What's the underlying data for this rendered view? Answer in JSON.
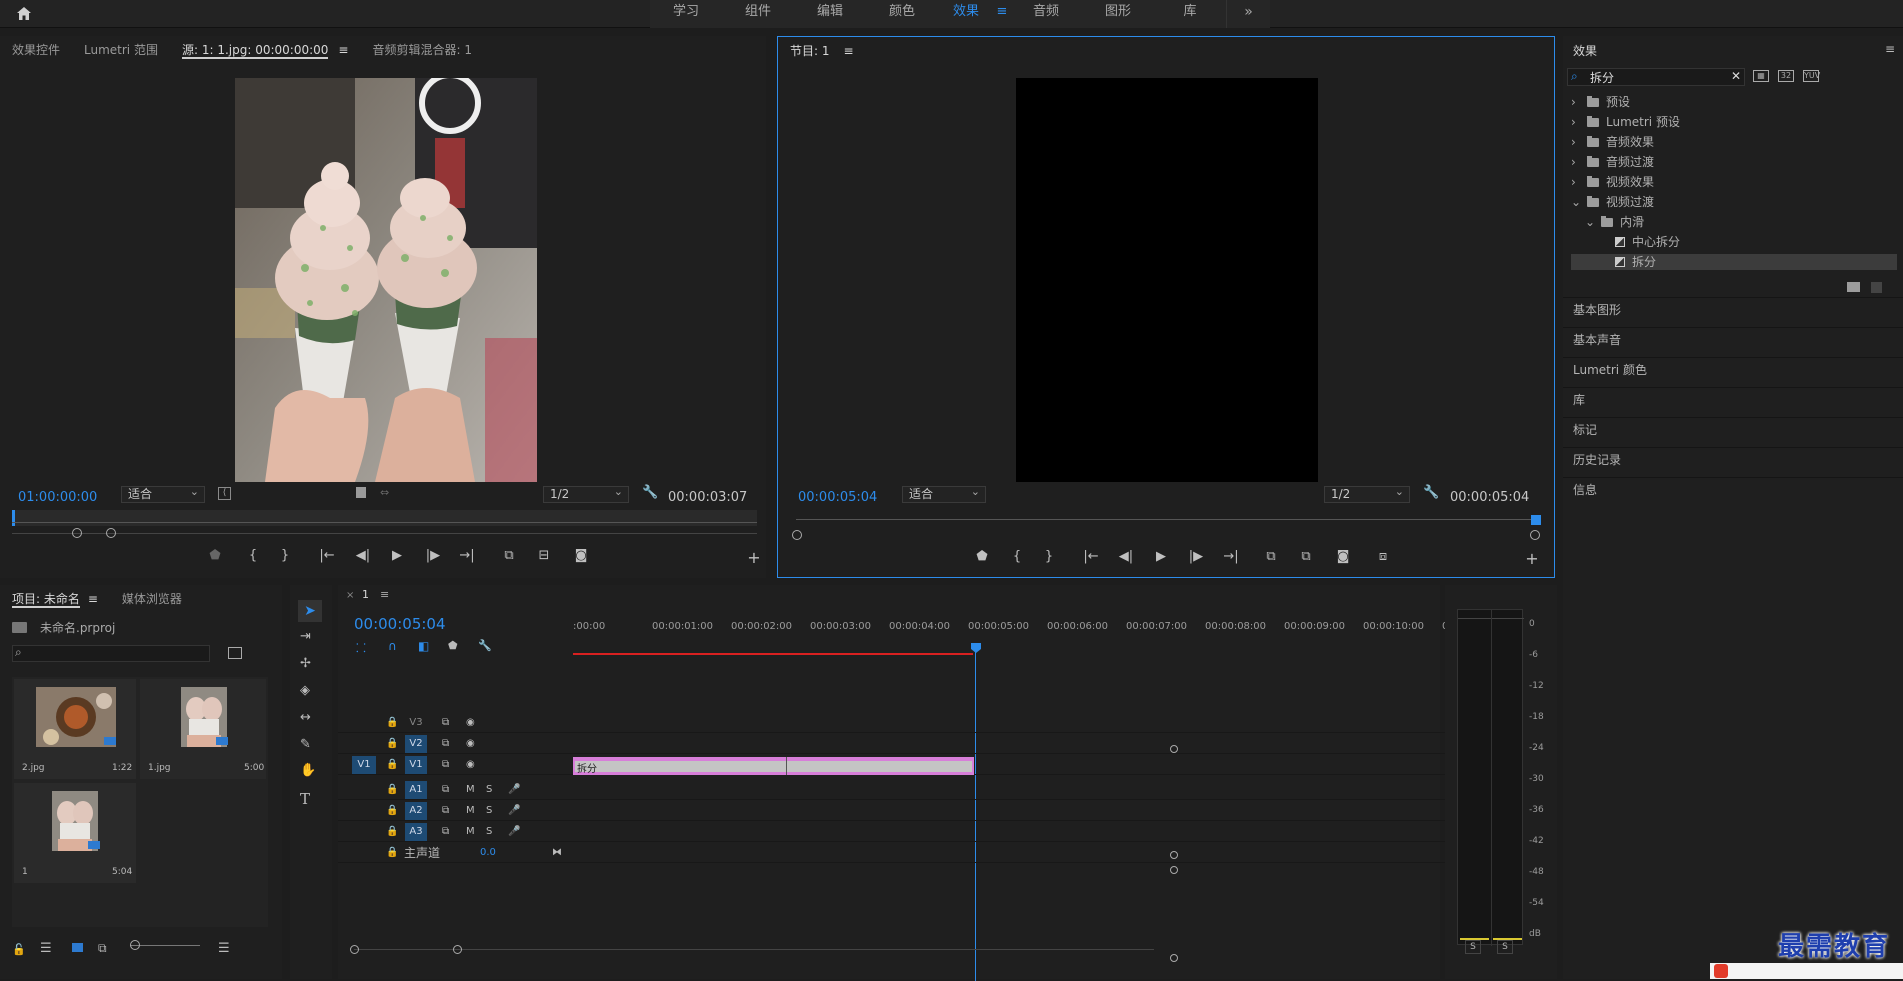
{
  "workspace": {
    "tabs": [
      {
        "label": "学习"
      },
      {
        "label": "组件"
      },
      {
        "label": "编辑"
      },
      {
        "label": "颜色"
      },
      {
        "label": "效果",
        "active": true
      },
      {
        "label": "音频"
      },
      {
        "label": "图形"
      },
      {
        "label": "库"
      }
    ],
    "more": "»"
  },
  "source_panel": {
    "tabs": [
      "效果控件",
      "Lumetri 范围",
      "源: 1: 1.jpg: 00:00:00:00",
      "音频剪辑混合器: 1"
    ],
    "timecode": "01:00:00:00",
    "fit": "适合",
    "resolution": "1/2",
    "duration": "00:00:03:07"
  },
  "program_panel": {
    "title": "节目: 1",
    "timecode": "00:00:05:04",
    "fit": "适合",
    "resolution": "1/2",
    "duration": "00:00:05:04"
  },
  "effects_panel": {
    "title": "效果",
    "search_value": "拆分",
    "tree": [
      {
        "label": "预设",
        "level": 0,
        "type": "bin",
        "expanded": false
      },
      {
        "label": "Lumetri 预设",
        "level": 0,
        "type": "bin",
        "expanded": false
      },
      {
        "label": "音频效果",
        "level": 0,
        "type": "folder",
        "expanded": false
      },
      {
        "label": "音频过渡",
        "level": 0,
        "type": "folder",
        "expanded": false
      },
      {
        "label": "视频效果",
        "level": 0,
        "type": "folder",
        "expanded": false
      },
      {
        "label": "视频过渡",
        "level": 0,
        "type": "folder",
        "expanded": true
      },
      {
        "label": "内滑",
        "level": 1,
        "type": "folder",
        "expanded": true
      },
      {
        "label": "中心拆分",
        "level": 2,
        "type": "effect"
      },
      {
        "label": "拆分",
        "level": 2,
        "type": "effect",
        "selected": true
      }
    ],
    "sections": [
      "基本图形",
      "基本声音",
      "Lumetri 颜色",
      "库",
      "标记",
      "历史记录",
      "信息"
    ]
  },
  "project_panel": {
    "tabs": [
      "项目: 未命名",
      "媒体浏览器"
    ],
    "project_file": "未命名.prproj",
    "items": [
      {
        "name": "2.jpg",
        "duration": "1:22"
      },
      {
        "name": "1.jpg",
        "duration": "5:00"
      },
      {
        "name": "1",
        "duration": "5:04"
      }
    ]
  },
  "timeline": {
    "sequence": "1",
    "timecode": "00:00:05:04",
    "ruler": [
      ":00:00",
      "00:00:01:00",
      "00:00:02:00",
      "00:00:03:00",
      "00:00:04:00",
      "00:00:05:00",
      "00:00:06:00",
      "00:00:07:00",
      "00:00:08:00",
      "00:00:09:00",
      "00:00:10:00",
      "0"
    ],
    "video_tracks": [
      "V3",
      "V2",
      "V1"
    ],
    "audio_tracks": [
      "A1",
      "A2",
      "A3"
    ],
    "source_patch": "V1",
    "master_label": "主声道",
    "master_value": "0.0",
    "clip_label": "拆分",
    "mute": "M",
    "solo": "S"
  },
  "meter": {
    "ticks": [
      "0",
      "-6",
      "-12",
      "-18",
      "-24",
      "-30",
      "-36",
      "-42",
      "-48",
      "-54",
      "dB"
    ],
    "solo_buttons": [
      "S",
      "S"
    ]
  },
  "watermark": "最需教育",
  "colors": {
    "accent": "#2d8ceb",
    "clip": "#d77ed9",
    "track_label": "#1e4b74",
    "playhead": "#2d8ceb",
    "work_area": "#d82020"
  }
}
